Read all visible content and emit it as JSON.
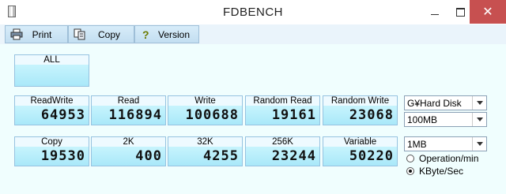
{
  "window": {
    "title": "FDBENCH",
    "close_glyph": "✕"
  },
  "toolbar": {
    "print_label": "Print",
    "copy_label": "Copy",
    "version_label": "Version"
  },
  "results": {
    "all": {
      "label": "ALL",
      "value": ""
    },
    "readwrite": {
      "label": "ReadWrite",
      "value": "64953"
    },
    "read": {
      "label": "Read",
      "value": "116894"
    },
    "write": {
      "label": "Write",
      "value": "100688"
    },
    "random_read": {
      "label": "Random Read",
      "value": "19161"
    },
    "random_write": {
      "label": "Random Write",
      "value": "23068"
    },
    "copy": {
      "label": "Copy",
      "value": "19530"
    },
    "k2": {
      "label": "2K",
      "value": "400"
    },
    "k32": {
      "label": "32K",
      "value": "4255"
    },
    "k256": {
      "label": "256K",
      "value": "23244"
    },
    "variable": {
      "label": "Variable",
      "value": "50220"
    }
  },
  "options": {
    "drive": "G¥Hard Disk",
    "test_size": "100MB",
    "block_size": "1MB",
    "unit_operation": "Operation/min",
    "unit_kbyte": "KByte/Sec",
    "selected_unit": "KByte/Sec"
  }
}
